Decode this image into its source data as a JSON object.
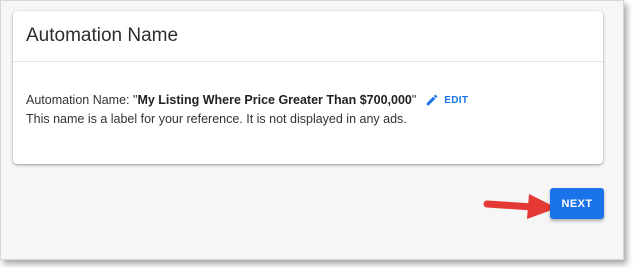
{
  "card": {
    "title": "Automation Name",
    "name_prefix": "Automation Name: \"",
    "name_value": "My Listing Where Price Greater Than $700,000",
    "name_suffix": "\"",
    "edit_label": "EDIT",
    "description": "This name is a label for your reference. It is not displayed in any ads."
  },
  "footer": {
    "next_label": "NEXT"
  },
  "colors": {
    "accent": "#1a73e8",
    "annotation_arrow": "#e53935"
  },
  "icons": {
    "edit": "pencil-icon",
    "annotation": "red-arrow-icon"
  }
}
